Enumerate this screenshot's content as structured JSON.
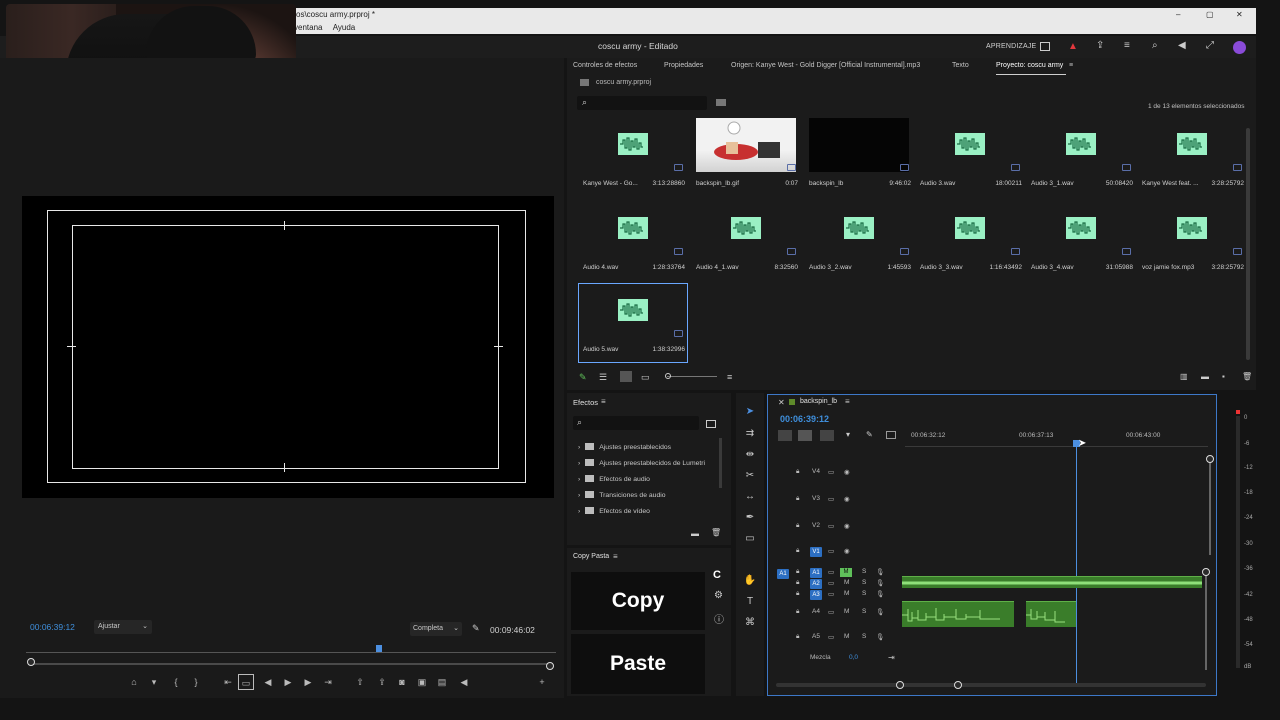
{
  "window": {
    "path_title": "vos\\coscu army.prproj *",
    "menu": [
      "ventana",
      "Ayuda"
    ],
    "app_title": "coscu army - Editado",
    "learn_label": "APRENDIZAJE"
  },
  "program_monitor": {
    "timecode": "00:06:39:12",
    "fit": "Ajustar",
    "quality": "Completa",
    "duration": "00:09:46:02"
  },
  "project_panel": {
    "tabs": [
      "Controles de efectos",
      "Propiedades",
      "Origen: Kanye West - Gold Digger [Official Instrumental].mp3",
      "Texto",
      "Proyecto: coscu army"
    ],
    "path": "coscu army.prproj",
    "selection_count": "1 de 13 elementos seleccionados",
    "items": [
      {
        "name": "Kanye West - Go...",
        "duration": "3:13:28860",
        "kind": "audio"
      },
      {
        "name": "backspin_lb.gif",
        "duration": "0:07",
        "kind": "gif"
      },
      {
        "name": "backspin_lb",
        "duration": "9:46:02",
        "kind": "sequence"
      },
      {
        "name": "Audio 3.wav",
        "duration": "18:00211",
        "kind": "audio"
      },
      {
        "name": "Audio 3_1.wav",
        "duration": "50:08420",
        "kind": "audio"
      },
      {
        "name": "Kanye West feat. ...",
        "duration": "3:28:25792",
        "kind": "audio"
      },
      {
        "name": "Audio 4.wav",
        "duration": "1:28:33764",
        "kind": "audio"
      },
      {
        "name": "Audio 4_1.wav",
        "duration": "8:32560",
        "kind": "audio"
      },
      {
        "name": "Audio 3_2.wav",
        "duration": "1:45593",
        "kind": "audio"
      },
      {
        "name": "Audio 3_3.wav",
        "duration": "1:16:43492",
        "kind": "audio"
      },
      {
        "name": "Audio 3_4.wav",
        "duration": "31:05988",
        "kind": "audio"
      },
      {
        "name": "voz jamie fox.mp3",
        "duration": "3:28:25792",
        "kind": "audio"
      },
      {
        "name": "Audio 5.wav",
        "duration": "1:38:32996",
        "kind": "audio"
      }
    ]
  },
  "effects_panel": {
    "title": "Efectos",
    "folders": [
      "Ajustes preestablecidos",
      "Ajustes preestablecidos de Lumetri",
      "Efectos de audio",
      "Transiciones de audio",
      "Efectos de vídeo"
    ]
  },
  "copy_pasta": {
    "title": "Copy Pasta",
    "copy_label": "Copy",
    "paste_label": "Paste"
  },
  "timeline": {
    "sequence_name": "backspin_lb",
    "timecode": "00:06:39:12",
    "ruler": [
      "00:06:32:12",
      "00:06:37:13",
      "00:06:43:00"
    ],
    "video_tracks": [
      "V4",
      "V3",
      "V2",
      "V1"
    ],
    "audio_tracks": [
      "A1",
      "A2",
      "A3",
      "A4",
      "A5"
    ],
    "mix_label": "Mezcla",
    "mix_value": "0,0",
    "meter_scale": [
      "0",
      "-6",
      "-12",
      "-18",
      "-24",
      "-30",
      "-36",
      "-42",
      "-48",
      "-54",
      "dB"
    ]
  }
}
